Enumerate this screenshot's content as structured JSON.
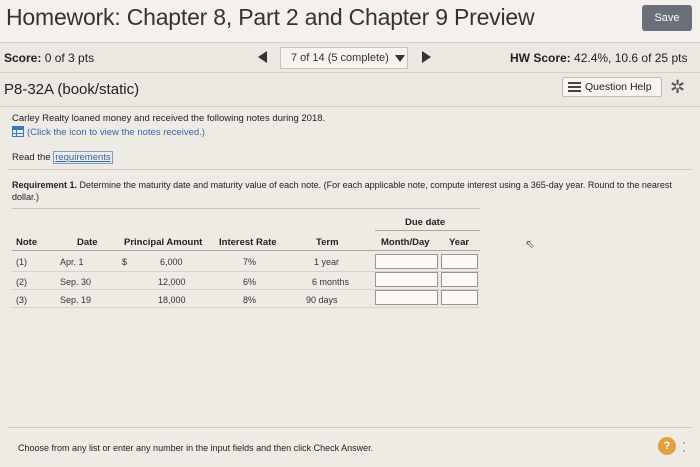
{
  "header": {
    "title": "Homework: Chapter 8, Part 2 and Chapter 9 Preview",
    "save_label": "Save"
  },
  "score_row": {
    "score_label": "Score:",
    "score_value": "0 of 3 pts",
    "nav_text": "7 of 14 (5 complete)",
    "hw_label": "HW Score:",
    "hw_value": "42.4%, 10.6 of 25 pts"
  },
  "problem": {
    "id": "P8-32A (book/static)",
    "question_help": "Question Help"
  },
  "content": {
    "intro": "Carley Realty loaned money and received the following notes during 2018.",
    "notes_link": "(Click the icon to view the notes received.)",
    "read_the": "Read the",
    "requirements_link": "requirements",
    "req_bold": "Requirement 1.",
    "req_text": " Determine the maturity date and maturity value of each note. (For each applicable note, compute interest using a 365-day year. Round to the nearest dollar.)"
  },
  "table": {
    "due_date_header": "Due date",
    "headers": [
      "Note",
      "Date",
      "Principal Amount",
      "Interest Rate",
      "Term",
      "Month/Day",
      "Year"
    ],
    "currency": "$",
    "rows": [
      {
        "note": "(1)",
        "date": "Apr. 1",
        "principal": "6,000",
        "rate": "7%",
        "term": "1 year"
      },
      {
        "note": "(2)",
        "date": "Sep. 30",
        "principal": "12,000",
        "rate": "6%",
        "term": "6 months"
      },
      {
        "note": "(3)",
        "date": "Sep. 19",
        "principal": "18,000",
        "rate": "8%",
        "term": "90 days"
      }
    ]
  },
  "footer": {
    "instruction": "Choose from any list or enter any number in the input fields and then click Check Answer.",
    "help": "?"
  },
  "icons": {
    "gear": "gear-icon",
    "notes_table": "table-icon",
    "question_help": "list-icon"
  }
}
